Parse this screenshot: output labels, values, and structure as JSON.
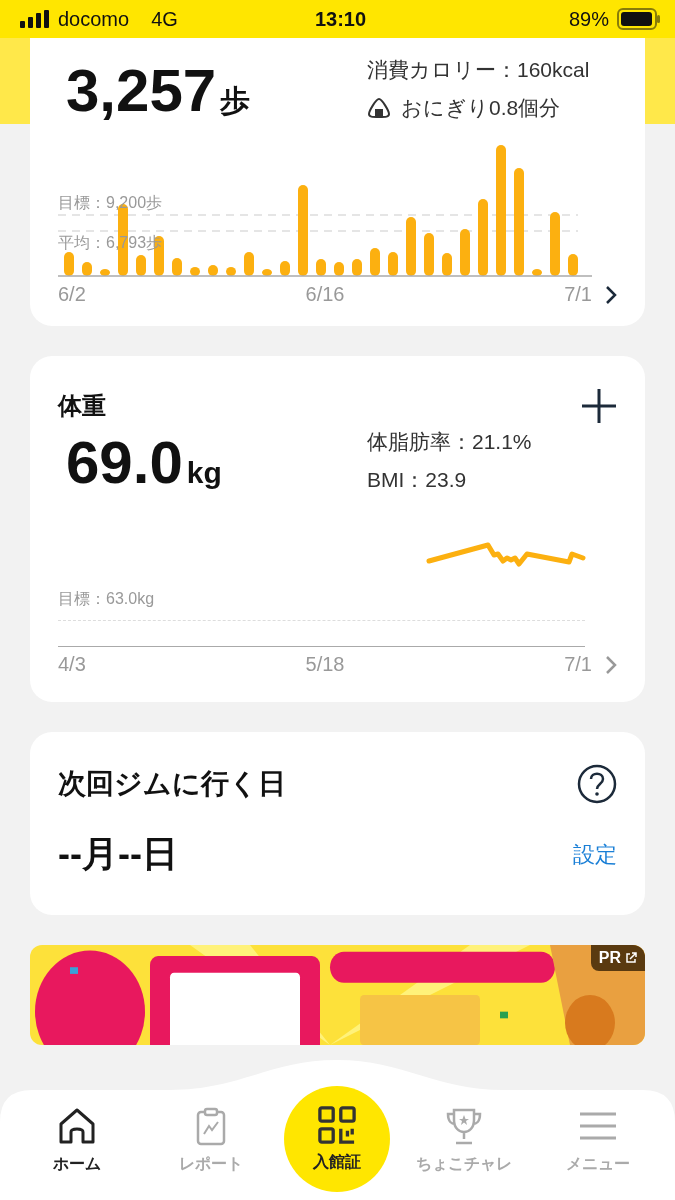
{
  "status_bar": {
    "carrier": "docomo",
    "network": "4G",
    "time": "13:10",
    "battery": "89%"
  },
  "steps_card": {
    "value": "3,257",
    "unit": "歩",
    "calories": "消費カロリー：160kcal",
    "equivalent": "おにぎり0.8個分",
    "goal_label": "目標：9,200歩",
    "average_label": "平均：6,793歩",
    "dates": [
      "6/2",
      "6/16",
      "7/1"
    ]
  },
  "weight_card": {
    "title": "体重",
    "value": "69.0",
    "unit": "kg",
    "body_fat": "体脂肪率：21.1%",
    "bmi": "BMI：23.9",
    "goal_label": "目標：63.0kg",
    "dates": [
      "4/3",
      "5/18",
      "7/1"
    ]
  },
  "gym_card": {
    "title": "次回ジムに行く日",
    "date": "--月--日",
    "action": "設定"
  },
  "banner": {
    "kind": "picture",
    "badge": "PR"
  },
  "bottom_nav": [
    {
      "label": "ホーム",
      "selected": true,
      "kind": "tab"
    },
    {
      "label": "レポート",
      "selected": false,
      "kind": "tab"
    },
    {
      "label": "入館証",
      "selected": false,
      "kind": "center"
    },
    {
      "label": "ちょこチャレ",
      "selected": false,
      "kind": "tab"
    },
    {
      "label": "メニュー",
      "selected": false,
      "kind": "tab"
    }
  ]
}
